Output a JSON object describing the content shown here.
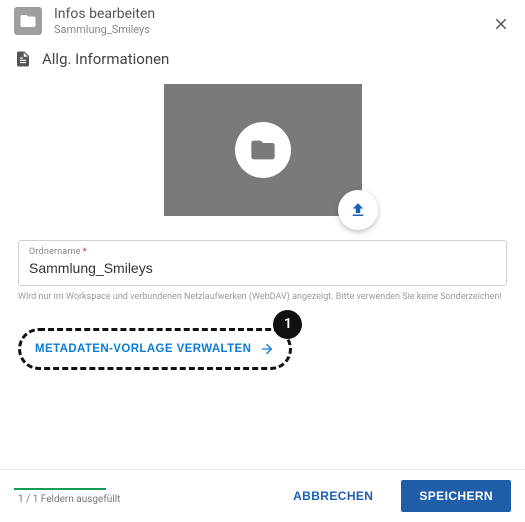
{
  "header": {
    "title": "Infos bearbeiten",
    "subtitle": "Sammlung_Smileys"
  },
  "section": {
    "general": "Allg. Informationen"
  },
  "field": {
    "label": "Ordnername",
    "value": "Sammlung_Smileys"
  },
  "helper": "Wird nur im Workspace und verbundenen Netzlaufwerken (WebDAV) angezeigt. Bitte verwenden Sie keine Sonderzeichen!",
  "metaLink": "METADATEN-VORLAGE VERWALTEN",
  "callout": "1",
  "footer": {
    "progress": "1 / 1 Feldern ausgefüllt",
    "cancel": "ABBRECHEN",
    "save": "SPEICHERN"
  }
}
